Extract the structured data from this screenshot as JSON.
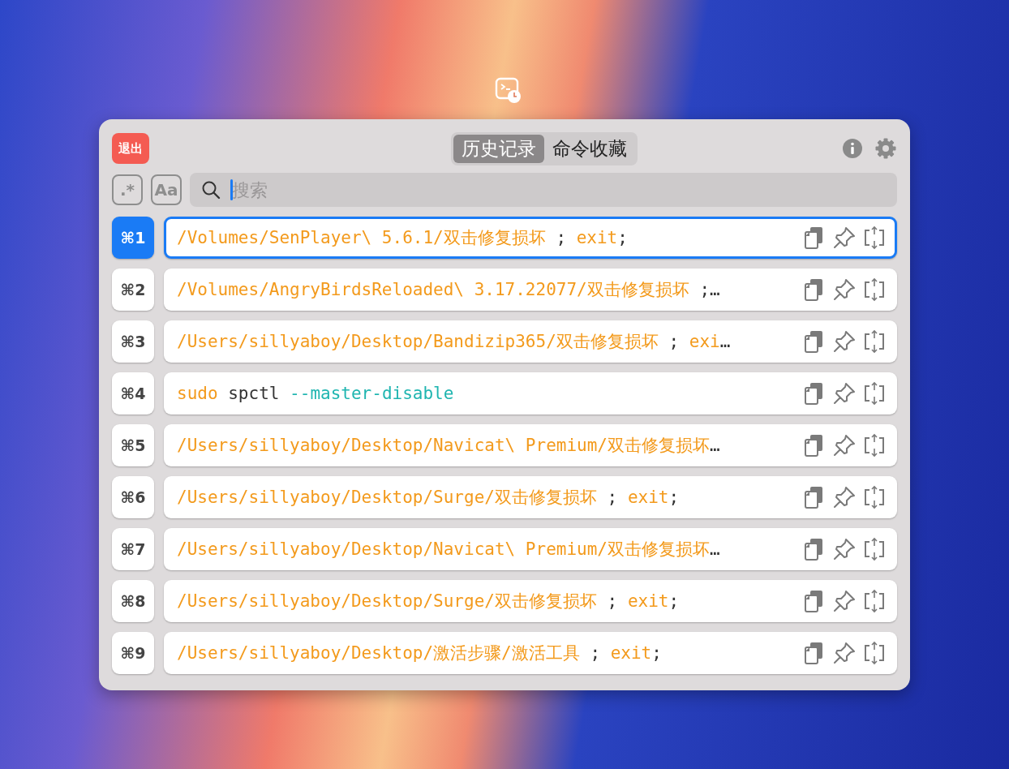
{
  "window": {
    "exit_button": "退出"
  },
  "tabs": [
    {
      "label": "历史记录",
      "selected": true
    },
    {
      "label": "命令收藏",
      "selected": false
    }
  ],
  "toggles": [
    {
      "label": ".*",
      "selected": false
    },
    {
      "label": "Aa",
      "selected": false
    }
  ],
  "search": {
    "placeholder": "搜索"
  },
  "rows": [
    {
      "key": "⌘1",
      "selected": true,
      "segments": [
        {
          "kind": "path",
          "text": "/Volumes/SenPlayer\\ 5.6.1/双击修复损坏"
        },
        {
          "kind": "plain",
          "text": " ; "
        },
        {
          "kind": "path",
          "text": "exit"
        },
        {
          "kind": "plain",
          "text": ";"
        }
      ]
    },
    {
      "key": "⌘2",
      "selected": false,
      "segments": [
        {
          "kind": "path",
          "text": "/Volumes/AngryBirdsReloaded\\ 3.17.22077/双击修复损坏"
        },
        {
          "kind": "plain",
          "text": " ;…"
        }
      ]
    },
    {
      "key": "⌘3",
      "selected": false,
      "segments": [
        {
          "kind": "path",
          "text": "/Users/sillyaboy/Desktop/Bandizip365/双击修复损坏"
        },
        {
          "kind": "plain",
          "text": " ; "
        },
        {
          "kind": "path",
          "text": "exi"
        },
        {
          "kind": "plain",
          "text": "…"
        }
      ]
    },
    {
      "key": "⌘4",
      "selected": false,
      "segments": [
        {
          "kind": "path",
          "text": "sudo"
        },
        {
          "kind": "plain",
          "text": " spctl "
        },
        {
          "kind": "flag",
          "text": "--master-disable"
        }
      ]
    },
    {
      "key": "⌘5",
      "selected": false,
      "segments": [
        {
          "kind": "path",
          "text": "/Users/sillyaboy/Desktop/Navicat\\ Premium/双击修复损坏"
        },
        {
          "kind": "plain",
          "text": "…"
        }
      ]
    },
    {
      "key": "⌘6",
      "selected": false,
      "segments": [
        {
          "kind": "path",
          "text": "/Users/sillyaboy/Desktop/Surge/双击修复损坏"
        },
        {
          "kind": "plain",
          "text": " ; "
        },
        {
          "kind": "path",
          "text": "exit"
        },
        {
          "kind": "plain",
          "text": ";"
        }
      ]
    },
    {
      "key": "⌘7",
      "selected": false,
      "segments": [
        {
          "kind": "path",
          "text": "/Users/sillyaboy/Desktop/Navicat\\ Premium/双击修复损坏"
        },
        {
          "kind": "plain",
          "text": "…"
        }
      ]
    },
    {
      "key": "⌘8",
      "selected": false,
      "segments": [
        {
          "kind": "path",
          "text": "/Users/sillyaboy/Desktop/Surge/双击修复损坏"
        },
        {
          "kind": "plain",
          "text": " ; "
        },
        {
          "kind": "path",
          "text": "exit"
        },
        {
          "kind": "plain",
          "text": ";"
        }
      ]
    },
    {
      "key": "⌘9",
      "selected": false,
      "segments": [
        {
          "kind": "path",
          "text": "/Users/sillyaboy/Desktop/激活步骤/激活工具"
        },
        {
          "kind": "plain",
          "text": " ; "
        },
        {
          "kind": "path",
          "text": "exit"
        },
        {
          "kind": "plain",
          "text": ";"
        }
      ]
    }
  ]
}
